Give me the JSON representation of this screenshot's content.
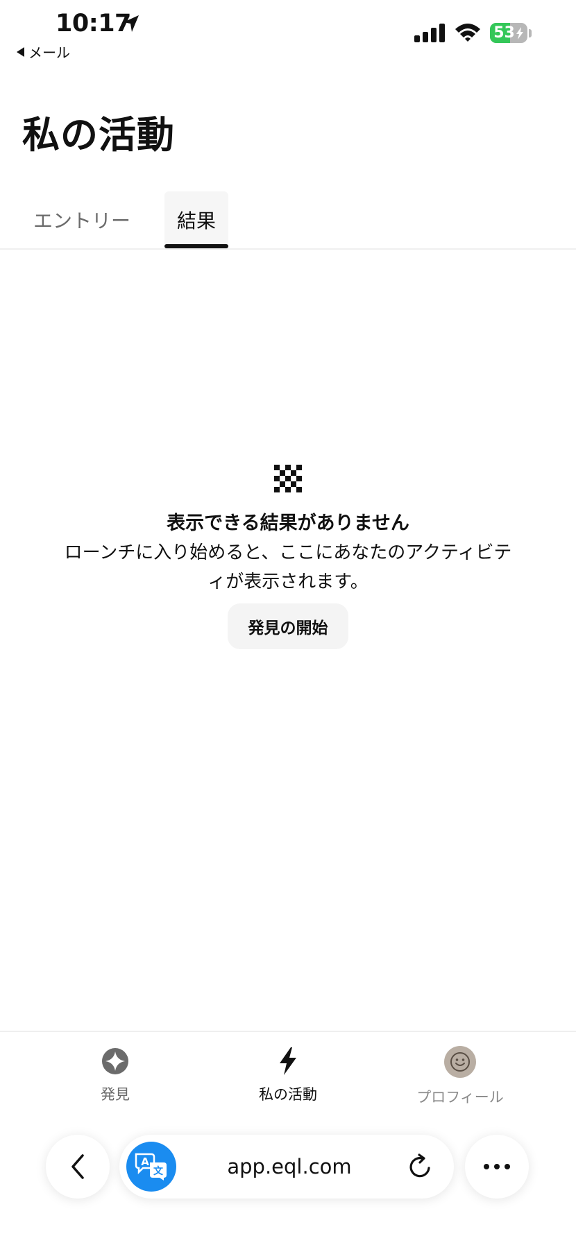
{
  "status_bar": {
    "time": "10:17",
    "back_app_label": "メール",
    "battery_percent": "53",
    "battery_level": 0.53,
    "location_icon": "location-arrow-icon",
    "signal_icon": "cellular-signal-icon",
    "wifi_icon": "wifi-icon"
  },
  "header": {
    "title": "私の活動"
  },
  "tabs": [
    {
      "label": "エントリー",
      "selected": false
    },
    {
      "label": "結果",
      "selected": true
    }
  ],
  "empty_state": {
    "icon": "eql-logo-icon",
    "title": "表示できる結果がありません",
    "description": "ローンチに入り始めると、ここにあなたのアクティビティが表示されます。",
    "button_label": "発見の開始"
  },
  "bottom_nav": [
    {
      "label": "発見",
      "icon": "sparkle-icon",
      "active": false
    },
    {
      "label": "私の活動",
      "icon": "lightning-bolt-icon",
      "active": true
    },
    {
      "label": "プロフィール",
      "icon": "smiley-avatar-icon",
      "active": false
    }
  ],
  "browser": {
    "url": "app.eql.com",
    "translate_icon": "translate-icon",
    "back_icon": "chevron-left-icon",
    "reload_icon": "reload-icon",
    "more_icon": "more-dots-icon"
  },
  "colors": {
    "accent_blue": "#1a8cf0",
    "battery_green": "#34c759",
    "text_primary": "#111111",
    "text_secondary": "#6b6b6b",
    "button_bg": "#f4f4f4"
  }
}
